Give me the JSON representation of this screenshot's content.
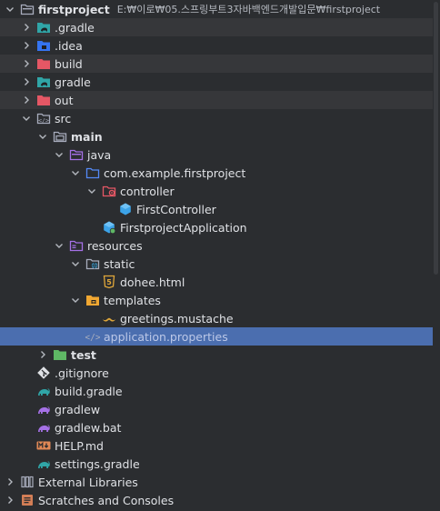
{
  "tree": [
    {
      "label": "firstproject",
      "path": "E:₩이로₩05.스프링부트3자바백엔드개발입문₩firstproject",
      "icon": "module-folder-icon",
      "chevron": "down",
      "level": 0,
      "bold": true
    },
    {
      "label": ".gradle",
      "icon": "gradle-folder-icon",
      "chevron": "right",
      "level": 1,
      "excluded": true
    },
    {
      "label": ".idea",
      "icon": "idea-folder-icon",
      "chevron": "right",
      "level": 1
    },
    {
      "label": "build",
      "icon": "excluded-folder-icon",
      "chevron": "right",
      "level": 1,
      "excluded": true
    },
    {
      "label": "gradle",
      "icon": "gradle-folder-icon",
      "chevron": "right",
      "level": 1
    },
    {
      "label": "out",
      "icon": "excluded-folder-icon",
      "chevron": "right",
      "level": 1,
      "excluded": true
    },
    {
      "label": "src",
      "icon": "source-folder-icon",
      "chevron": "down",
      "level": 1
    },
    {
      "label": "main",
      "icon": "main-folder-icon",
      "chevron": "down",
      "level": 2,
      "bold": true
    },
    {
      "label": "java",
      "icon": "java-source-root-icon",
      "chevron": "down",
      "level": 3
    },
    {
      "label": "com.example.firstproject",
      "icon": "package-icon",
      "chevron": "down",
      "level": 4
    },
    {
      "label": "controller",
      "icon": "controller-package-icon",
      "chevron": "down",
      "level": 5
    },
    {
      "label": "FirstController",
      "icon": "class-icon",
      "chevron": "none",
      "level": 6
    },
    {
      "label": "FirstprojectApplication",
      "icon": "spring-app-icon",
      "chevron": "none",
      "level": 5
    },
    {
      "label": "resources",
      "icon": "resources-root-icon",
      "chevron": "down",
      "level": 3
    },
    {
      "label": "static",
      "icon": "web-folder-icon",
      "chevron": "down",
      "level": 4
    },
    {
      "label": "dohee.html",
      "icon": "html5-icon",
      "chevron": "none",
      "level": 5
    },
    {
      "label": "templates",
      "icon": "templates-folder-icon",
      "chevron": "down",
      "level": 4
    },
    {
      "label": "greetings.mustache",
      "icon": "mustache-icon",
      "chevron": "none",
      "level": 5
    },
    {
      "label": "application.properties",
      "icon": "properties-icon",
      "chevron": "none",
      "level": 4,
      "selected": true
    },
    {
      "label": "test",
      "icon": "test-folder-icon",
      "chevron": "right",
      "level": 2,
      "bold": true
    },
    {
      "label": ".gitignore",
      "icon": "git-icon",
      "chevron": "none",
      "level": 1
    },
    {
      "label": "build.gradle",
      "icon": "gradle-file-icon",
      "chevron": "none",
      "level": 1
    },
    {
      "label": "gradlew",
      "icon": "gradlew-icon",
      "chevron": "none",
      "level": 1
    },
    {
      "label": "gradlew.bat",
      "icon": "gradlew-icon",
      "chevron": "none",
      "level": 1
    },
    {
      "label": "HELP.md",
      "icon": "markdown-icon",
      "chevron": "none",
      "level": 1
    },
    {
      "label": "settings.gradle",
      "icon": "gradle-file-icon",
      "chevron": "none",
      "level": 1
    },
    {
      "label": "External Libraries",
      "icon": "libraries-icon",
      "chevron": "right",
      "level": 0
    },
    {
      "label": "Scratches and Consoles",
      "icon": "scratches-icon",
      "chevron": "right",
      "level": 0
    }
  ],
  "colors": {
    "background": "#2b2d30",
    "selection": "#4b6eaf",
    "excluded_row": "#36373a",
    "text": "#dfe1e5",
    "gradle_teal": "#30a5a7",
    "folder_blue": "#548af7",
    "excluded_red": "#e55765",
    "java_source": "#a571e6",
    "test_green": "#5fb865",
    "web_blue": "#3592c4",
    "templates_orange": "#f0a732",
    "html_orange": "#e0a73a"
  }
}
